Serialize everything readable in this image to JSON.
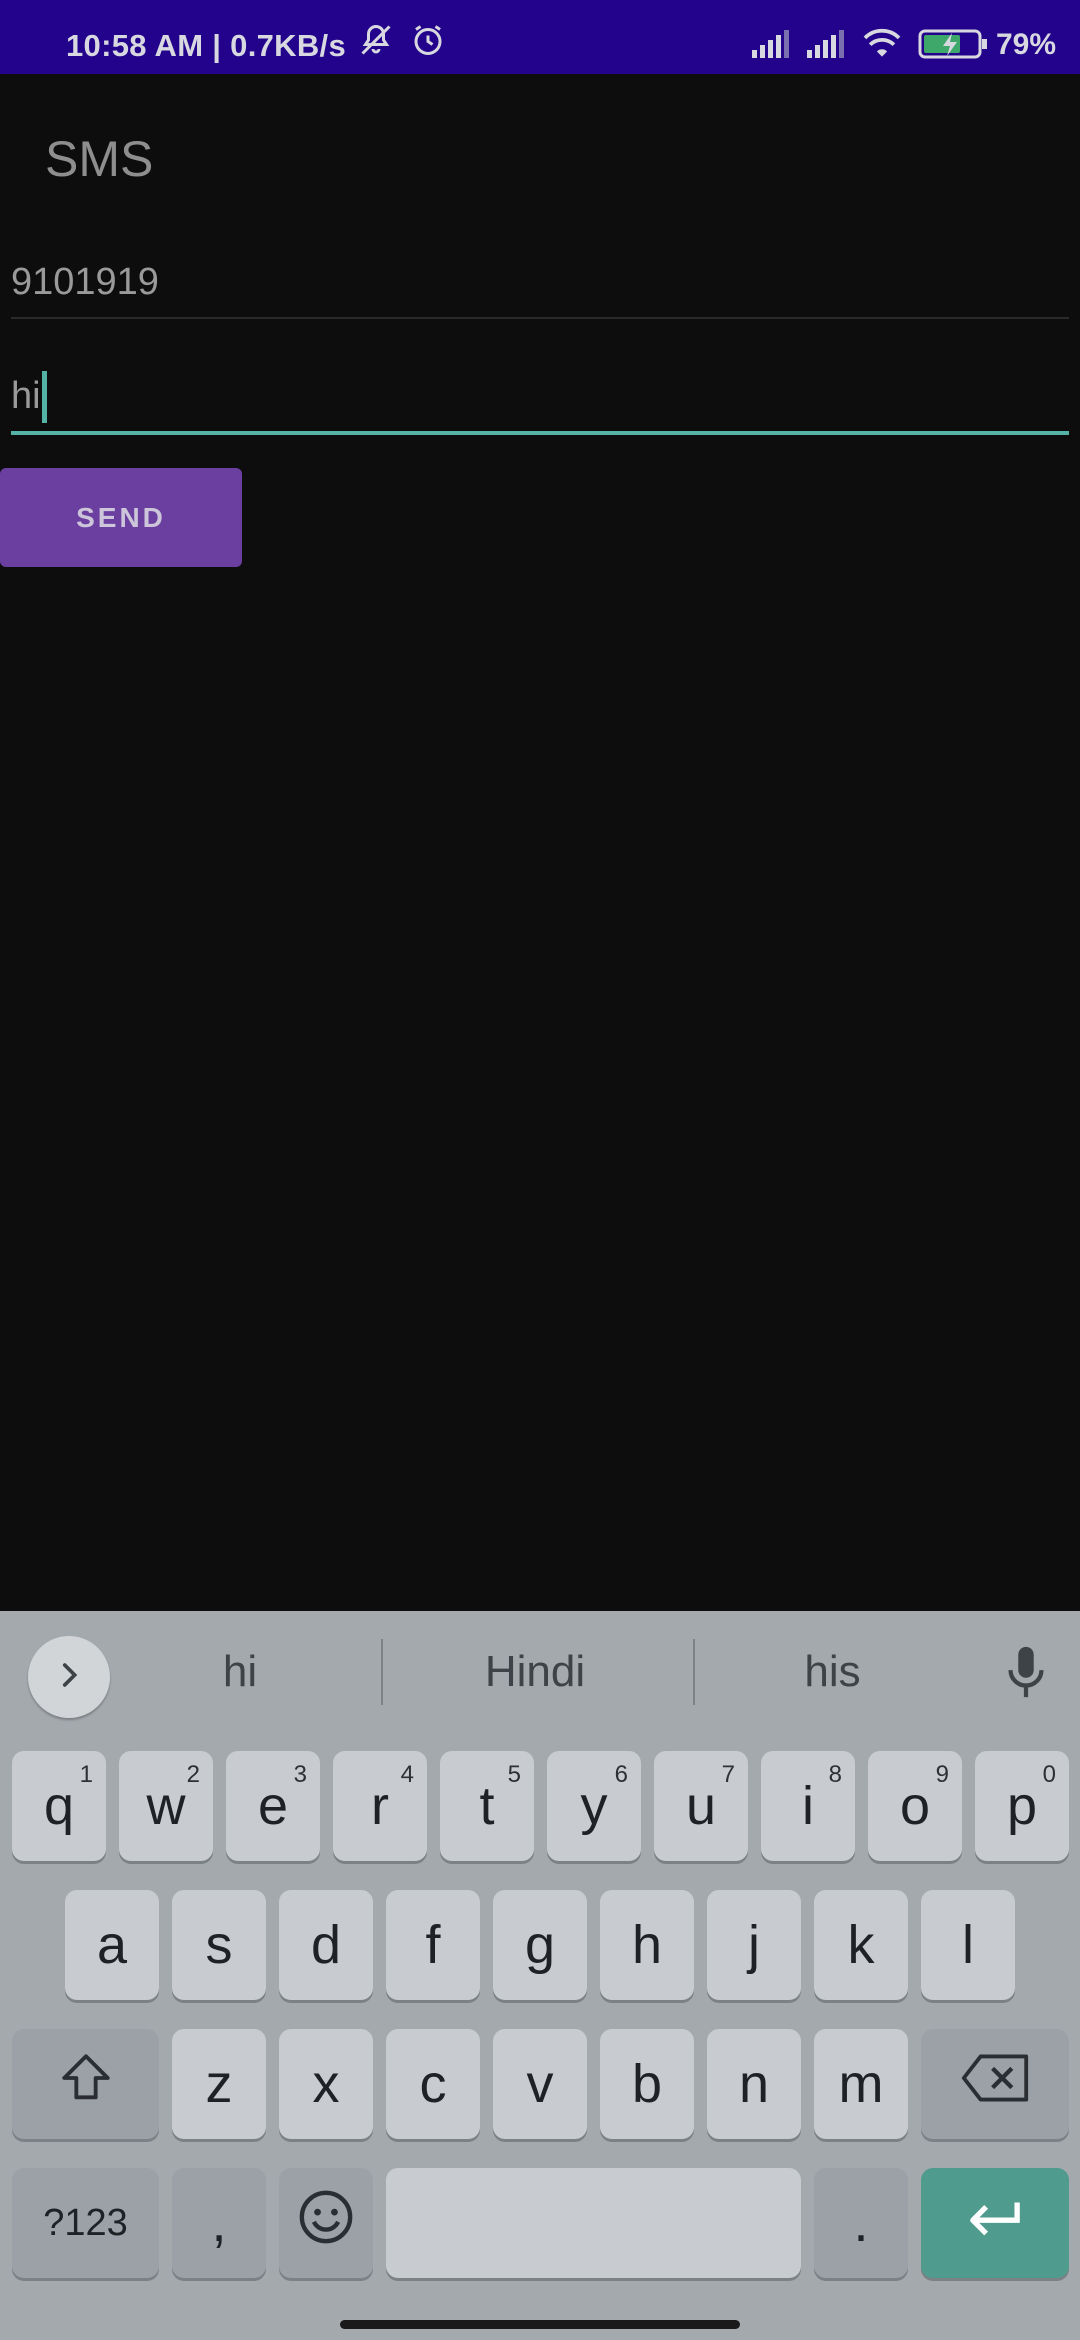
{
  "status_bar": {
    "time_speed": "10:58 AM | 0.7KB/s",
    "battery_percent": "79%",
    "icons": [
      "mute-icon",
      "alarm-icon",
      "signal-icon",
      "signal-icon",
      "wifi-icon",
      "battery-charging-icon"
    ]
  },
  "app": {
    "title": "SMS",
    "phone_value": "9101919",
    "message_value": "hi",
    "send_label": "SEND"
  },
  "keyboard": {
    "suggestions": [
      "hi",
      "Hindi",
      "his"
    ],
    "row1": [
      {
        "k": "q",
        "h": "1"
      },
      {
        "k": "w",
        "h": "2"
      },
      {
        "k": "e",
        "h": "3"
      },
      {
        "k": "r",
        "h": "4"
      },
      {
        "k": "t",
        "h": "5"
      },
      {
        "k": "y",
        "h": "6"
      },
      {
        "k": "u",
        "h": "7"
      },
      {
        "k": "i",
        "h": "8"
      },
      {
        "k": "o",
        "h": "9"
      },
      {
        "k": "p",
        "h": "0"
      }
    ],
    "row2": [
      "a",
      "s",
      "d",
      "f",
      "g",
      "h",
      "j",
      "k",
      "l"
    ],
    "row3": [
      "z",
      "x",
      "c",
      "v",
      "b",
      "n",
      "m"
    ],
    "symbols_label": "?123",
    "comma_label": ",",
    "period_label": "."
  },
  "colors": {
    "status_bar": "#23038c",
    "background": "#0d0d0d",
    "accent": "#54b3a5",
    "send_button": "#6a3fa0",
    "keyboard": "#a4a9ae"
  }
}
